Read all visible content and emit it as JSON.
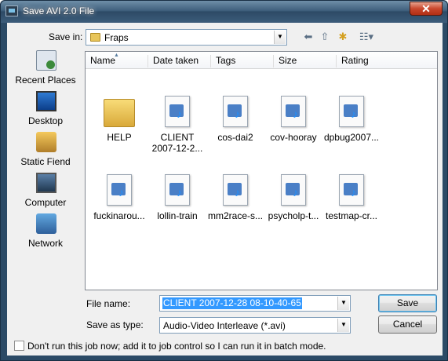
{
  "window": {
    "title": "Save AVI 2.0 File",
    "close_glyph": "✕"
  },
  "savein": {
    "label": "Save in:",
    "folder": "Fraps"
  },
  "toolbar": {
    "back": "⬅",
    "up": "⇧",
    "new_folder": "✱",
    "views": "☷▾"
  },
  "places": [
    {
      "label": "Recent Places",
      "icon": "recent-places-icon"
    },
    {
      "label": "Desktop",
      "icon": "desktop-icon"
    },
    {
      "label": "Static Fiend",
      "icon": "user-folder-icon"
    },
    {
      "label": "Computer",
      "icon": "computer-icon"
    },
    {
      "label": "Network",
      "icon": "network-icon"
    }
  ],
  "columns": [
    "Name",
    "Date taken",
    "Tags",
    "Size",
    "Rating"
  ],
  "sort_glyph": "▲",
  "items": [
    {
      "name": "HELP",
      "type": "folder"
    },
    {
      "name": "CLIENT\n2007-12-2...",
      "type": "file"
    },
    {
      "name": "cos-dai2",
      "type": "file"
    },
    {
      "name": "cov-hooray",
      "type": "file"
    },
    {
      "name": "dpbug2007...",
      "type": "file"
    },
    {
      "name": "fuckinarou...",
      "type": "file"
    },
    {
      "name": "lollin-train",
      "type": "file"
    },
    {
      "name": "mm2race-s...",
      "type": "file"
    },
    {
      "name": "psycholp-t...",
      "type": "file"
    },
    {
      "name": "testmap-cr...",
      "type": "file"
    }
  ],
  "filename": {
    "label": "File name:",
    "value": "CLIENT 2007-12-28 08-10-40-65"
  },
  "savetype": {
    "label": "Save as type:",
    "value": "Audio-Video Interleave (*.avi)"
  },
  "buttons": {
    "save": "Save",
    "cancel": "Cancel"
  },
  "batch_checkbox": {
    "label": "Don't run this job now; add it to job control so I can run it in batch mode.",
    "checked": false
  },
  "combo_arrow": "▼"
}
